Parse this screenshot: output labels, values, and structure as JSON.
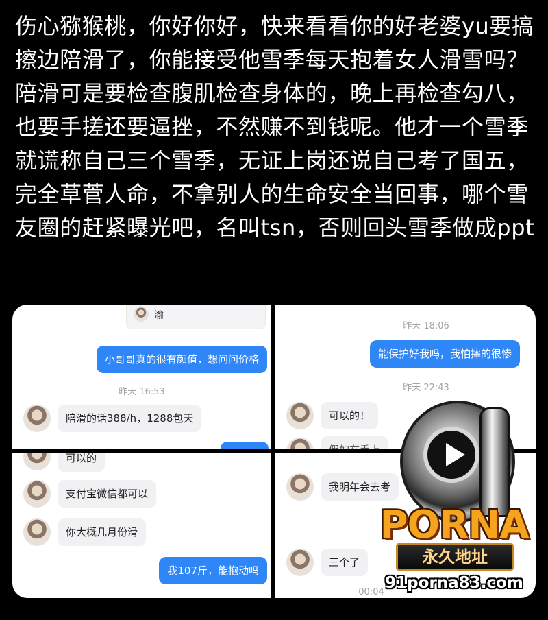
{
  "post": {
    "text": "伤心猕猴桃，你好你好，快来看看你的好老婆yu要搞擦边陪滑了，你能接受他雪季每天抱着女人滑雪吗？陪滑可是要检查腹肌检查身体的，晚上再检查勾八，也要手搓还要逼挫，不然赚不到钱呢。他才一个雪季就谎称自己三个雪季，无证上岗还说自己考了国五，完全草菅人命，不拿别人的生命安全当回事，哪个雪友圈的赶紧曝光吧，名叫tsn，否则回头雪季做成ppt"
  },
  "screenshots": {
    "top_left": {
      "card_name": "渝",
      "out_1": "小哥哥真的很有颜值，想问问价格",
      "time_1": "昨天 16:53",
      "in_1": "陪滑的话388/h，1288包天"
    },
    "top_right": {
      "time_1": "昨天 18:06",
      "out_1": "能保护好我吗，我怕摔的很惨",
      "time_2": "昨天 22:43",
      "in_1": "可以的！",
      "in_2_partial": "假如在手上"
    },
    "bottom_left": {
      "in_0_partial": "可以的",
      "in_1": "支付宝微信都可以",
      "in_2": "你大概几月份滑",
      "out_1": "我107斤，能抱动吗"
    },
    "bottom_right": {
      "in_1": "我明年会去考",
      "in_2": "三个了",
      "time_partial": "00:04"
    }
  },
  "watermark": {
    "number": "91",
    "brand": "PORNA",
    "banner": "永久地址",
    "url": "91porna83.com"
  }
}
